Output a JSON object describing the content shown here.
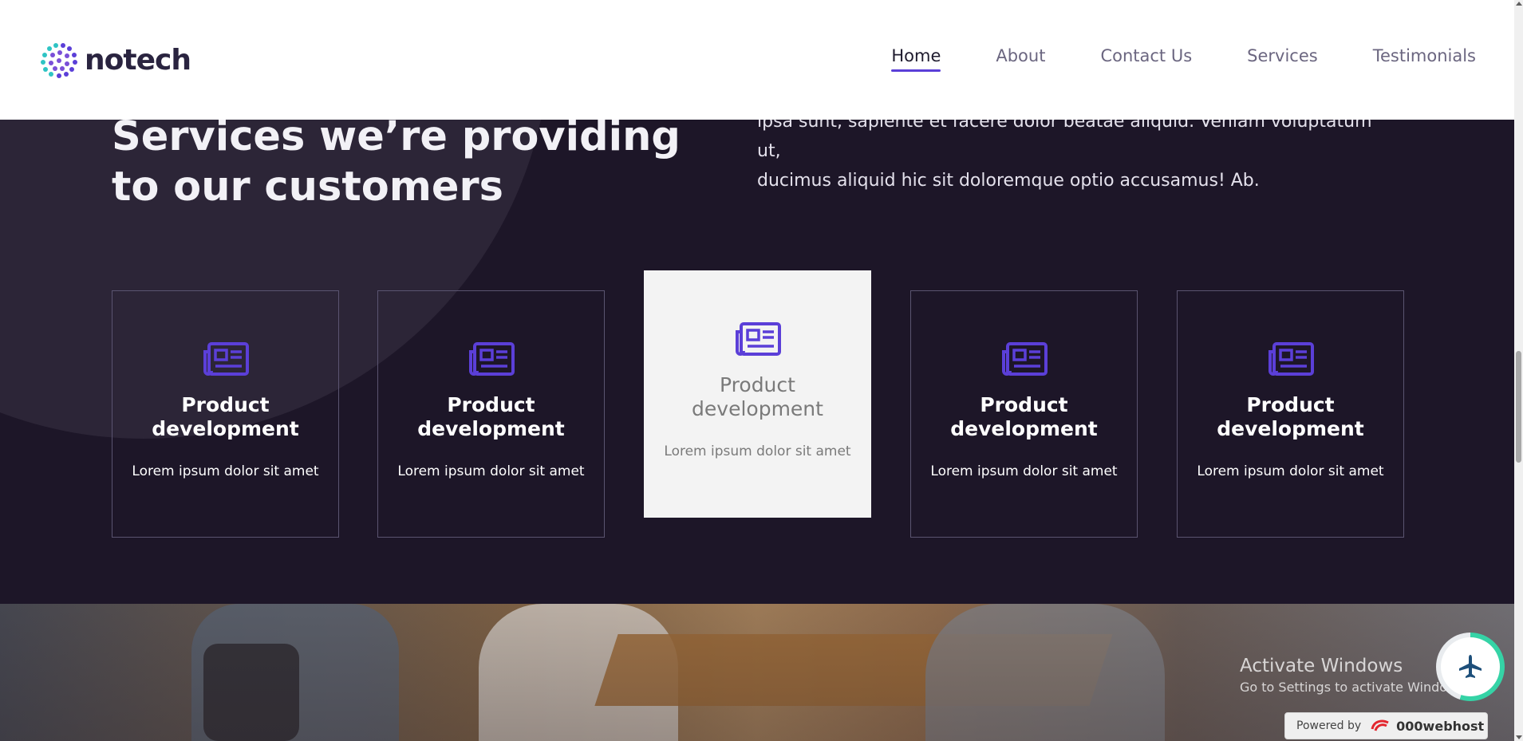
{
  "header": {
    "logo_text": "notech",
    "nav": [
      {
        "label": "Home",
        "active": true
      },
      {
        "label": "About",
        "active": false
      },
      {
        "label": "Contact Us",
        "active": false
      },
      {
        "label": "Services",
        "active": false
      },
      {
        "label": "Testimonials",
        "active": false
      }
    ]
  },
  "services": {
    "heading_line1": "Services we’re providing",
    "heading_line2": "to our customers",
    "intro_line1": "ipsa sunt, sapiente et facere dolor beatae aliquid. Veniam voluptatum ut,",
    "intro_line2": "ducimus aliquid hic sit doloremque optio accusamus! Ab.",
    "cards": [
      {
        "icon": "newspaper-icon",
        "title_line1": "Product",
        "title_line2": "development",
        "text": "Lorem ipsum dolor sit amet",
        "active": false
      },
      {
        "icon": "newspaper-icon",
        "title_line1": "Product",
        "title_line2": "development",
        "text": "Lorem ipsum dolor sit amet",
        "active": false
      },
      {
        "icon": "newspaper-icon",
        "title_line1": "Product",
        "title_line2": "development",
        "text": "Lorem ipsum dolor sit amet",
        "active": true
      },
      {
        "icon": "newspaper-icon",
        "title_line1": "Product",
        "title_line2": "development",
        "text": "Lorem ipsum dolor sit amet",
        "active": false
      },
      {
        "icon": "newspaper-icon",
        "title_line1": "Product",
        "title_line2": "development",
        "text": "Lorem ipsum dolor sit amet",
        "active": false
      }
    ]
  },
  "overlay": {
    "activate_title": "Activate Windows",
    "activate_sub": "Go to Settings to activate Windows.",
    "powered_label": "Powered by",
    "powered_brand": "000webhost",
    "fab_icon": "airplane-icon"
  },
  "colors": {
    "accent": "#5b3fd8",
    "dark_bg": "#1d1628",
    "card_active_bg": "#f3f3f3",
    "fab_ring": "#35d3a6"
  }
}
